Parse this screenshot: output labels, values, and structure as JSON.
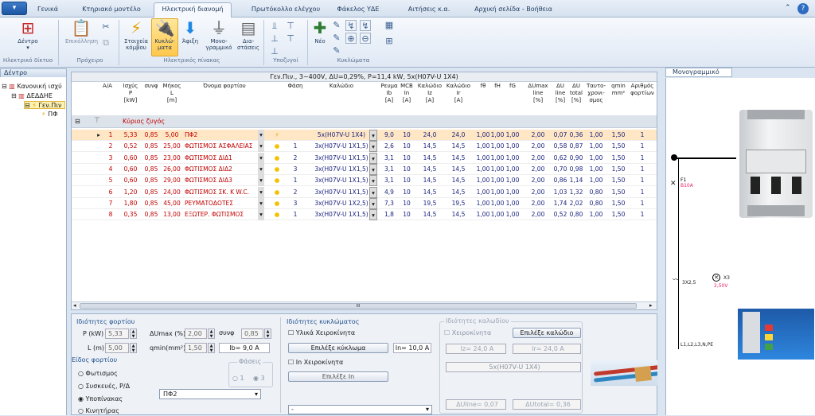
{
  "menu": {
    "tabs": [
      "Γενικά",
      "Κτηριακό μοντέλο",
      "Ηλεκτρική διανομή",
      "Πρωτόκολλο ελέγχου",
      "Φάκελος ΥΔΕ",
      "Αιτήσεις κ.α.",
      "Αρχική σελίδα - Βοήθεια"
    ],
    "active_tab": "Ηλεκτρική διανομή"
  },
  "ribbon": {
    "groups": [
      "Ηλεκτρικό δίκτυο",
      "Πρόχειρο",
      "Ηλεκτρικός πίνακας",
      "Υποζυγοί",
      "Κυκλώματα"
    ],
    "tree_btn": [
      "Δέντρο"
    ],
    "paste_btn": [
      "Επικόλληση"
    ],
    "elements_btn": [
      "Στοιχεία",
      "κόμβου"
    ],
    "circuits_btn": [
      "Κυκλώ-",
      "ματα"
    ],
    "arrival_btn": [
      "Άφιξη"
    ],
    "single_line_btn": [
      "Μονο-",
      "γραμμικό"
    ],
    "dimensions_btn": [
      "Δια-",
      "στάσεις"
    ],
    "new_btn": [
      "Νέο"
    ]
  },
  "tree": {
    "header": "Δέντρο",
    "nodes": [
      "Κανονική ισχύ",
      "ΔΕΔΔΗΕ",
      "Γεν.Πιν",
      "ΠΦ"
    ]
  },
  "grid": {
    "title": "Γεν.Πιν., 3~400V, ΔU=0,29%, P=11,4 kW, 5x(H07V-U 1X4)",
    "headers": {
      "aa": [
        "Α/Α"
      ],
      "p": [
        "Ισχύς",
        "P",
        "[kW]"
      ],
      "cos": [
        "συνφ"
      ],
      "l": [
        "Μήκος",
        "L",
        "[m]"
      ],
      "name": [
        "Όνομα φορτίου"
      ],
      "phase": [
        "Φάση"
      ],
      "cable": [
        "Καλώδιο"
      ],
      "ib": [
        "Ρευμα",
        "Ib",
        "[A]"
      ],
      "mcb": [
        "MCB",
        "In",
        "[A]"
      ],
      "iz": [
        "Καλώδιο",
        "Iz",
        "[A]"
      ],
      "ir": [
        "Καλώδιο",
        "Ir",
        "[A]"
      ],
      "fth": [
        "fθ"
      ],
      "fh": [
        "fH"
      ],
      "fg": [
        "fG"
      ],
      "dumax": [
        "ΔUmax",
        "line",
        "[%]"
      ],
      "duline": [
        "ΔU",
        "line",
        "[%]"
      ],
      "dutotal": [
        "ΔU",
        "total",
        "[%]"
      ],
      "simul": [
        "Ταυτο-",
        "χρονι-",
        "σμος"
      ],
      "qmin": [
        "qmin",
        "mm²"
      ],
      "count": [
        "Αριθμός",
        "φορτίων"
      ]
    },
    "group_label": "Κύριος ζυγός",
    "rows": [
      [
        "1",
        "5,33",
        "0,85",
        "5,00",
        "ΠΦ2",
        "",
        "5x(H07V-U 1X4)",
        "9,0",
        "10",
        "24,0",
        "24,0",
        "1,00",
        "1,00",
        "1,00",
        "2,00",
        "0,07",
        "0,36",
        "1,00",
        "1,50",
        "1"
      ],
      [
        "2",
        "0,52",
        "0,85",
        "25,00",
        "ΦΩΤΙΣΜΟΣ ΑΣΦΑΛΕΙΑΣ",
        "1",
        "3x(H07V-U 1X1,5)",
        "2,6",
        "10",
        "14,5",
        "14,5",
        "1,00",
        "1,00",
        "1,00",
        "2,00",
        "0,58",
        "0,87",
        "1,00",
        "1,50",
        "1"
      ],
      [
        "3",
        "0,60",
        "0,85",
        "23,00",
        "ΦΩΤΙΣΜΟΣ ΔΙΔ1",
        "2",
        "3x(H07V-U 1X1,5)",
        "3,1",
        "10",
        "14,5",
        "14,5",
        "1,00",
        "1,00",
        "1,00",
        "2,00",
        "0,62",
        "0,90",
        "1,00",
        "1,50",
        "1"
      ],
      [
        "4",
        "0,60",
        "0,85",
        "26,00",
        "ΦΩΤΙΣΜΟΣ ΔΙΔ2",
        "3",
        "3x(H07V-U 1X1,5)",
        "3,1",
        "10",
        "14,5",
        "14,5",
        "1,00",
        "1,00",
        "1,00",
        "2,00",
        "0,70",
        "0,98",
        "1,00",
        "1,50",
        "1"
      ],
      [
        "5",
        "0,60",
        "0,85",
        "29,00",
        "ΦΩΤΙΣΜΟΣ ΔΙΔ3",
        "1",
        "3x(H07V-U 1X1,5)",
        "3,1",
        "10",
        "14,5",
        "14,5",
        "1,00",
        "1,00",
        "1,00",
        "2,00",
        "0,86",
        "1,14",
        "1,00",
        "1,50",
        "1"
      ],
      [
        "6",
        "1,20",
        "0,85",
        "24,00",
        "ΦΩΤΙΣΜΟΣ ΣΚ. K W.C.",
        "2",
        "3x(H07V-U 1X1,5)",
        "4,9",
        "10",
        "14,5",
        "14,5",
        "1,00",
        "1,00",
        "1,00",
        "2,00",
        "1,03",
        "1,32",
        "0,80",
        "1,50",
        "1"
      ],
      [
        "7",
        "1,80",
        "0,85",
        "45,00",
        "ΡΕΥΜΑΤΟΔΟΤΕΣ",
        "3",
        "3x(H07V-U 1X2,5)",
        "7,3",
        "10",
        "19,5",
        "19,5",
        "1,00",
        "1,00",
        "1,00",
        "2,00",
        "1,74",
        "2,02",
        "0,80",
        "1,50",
        "1"
      ],
      [
        "8",
        "0,35",
        "0,85",
        "13,00",
        "ΕΞΩΤΕΡ. ΦΩΤΙΣΜΟΣ",
        "1",
        "3x(H07V-U 1X1,5)",
        "1,8",
        "10",
        "14,5",
        "14,5",
        "1,00",
        "1,00",
        "1,00",
        "2,00",
        "0,52",
        "0,80",
        "1,00",
        "1,50",
        "1"
      ]
    ],
    "scroll_thumb": "III"
  },
  "load_props": {
    "title": "Ιδιότητες φορτίου",
    "p_label": "P (kW)",
    "p_value": "5,33",
    "l_label": "L (m)",
    "l_value": "5,00",
    "dumax_label": "ΔUmax (%)",
    "dumax_value": "2,00",
    "cos_label": "συνφ",
    "cos_value": "0,85",
    "qmin_label": "qmin(mm²)",
    "qmin_value": "1,50",
    "ib_text": "Ib= 9,0 A",
    "kind_title": "Είδος φορτίου",
    "kinds": [
      "Φωτισμος",
      "Συσκευές, Ρ/Δ",
      "Υποπίνακας",
      "Κινητήρας"
    ],
    "phases_label": "Φάσεις",
    "phase_opts": [
      "1",
      "3"
    ],
    "name_select": "ΠΦ2"
  },
  "circuit_props": {
    "title": "Ιδιότητες κυκλώματος",
    "manual_materials": "Υλικά Χειροκίνητα",
    "select_circuit": "Επιλέξε κύκλωμα",
    "in_text": "In= 10,0 A",
    "in_manual": "In Χειροκίνητα",
    "select_in": "Επιλέξε In",
    "bottom_select": "-"
  },
  "cable_props": {
    "title": "Ιδιότητες καλωδίου",
    "manual": "Χειροκίνητα",
    "select_cable": "Επιλέξε καλώδιο",
    "iz": "Iz= 24,0 A",
    "ir": "Ir= 24,0 A",
    "cable": "5x(H07V-U 1X4)",
    "duline": "ΔUline= 0,07",
    "dutotal": "ΔUtotal= 0,36"
  },
  "right_panel": {
    "header": "Μονογραμμικό",
    "labels": [
      "F1",
      "B10A",
      "3X2,5",
      "2,50V",
      "X3",
      "L1,L2,L3,N,PE"
    ]
  }
}
